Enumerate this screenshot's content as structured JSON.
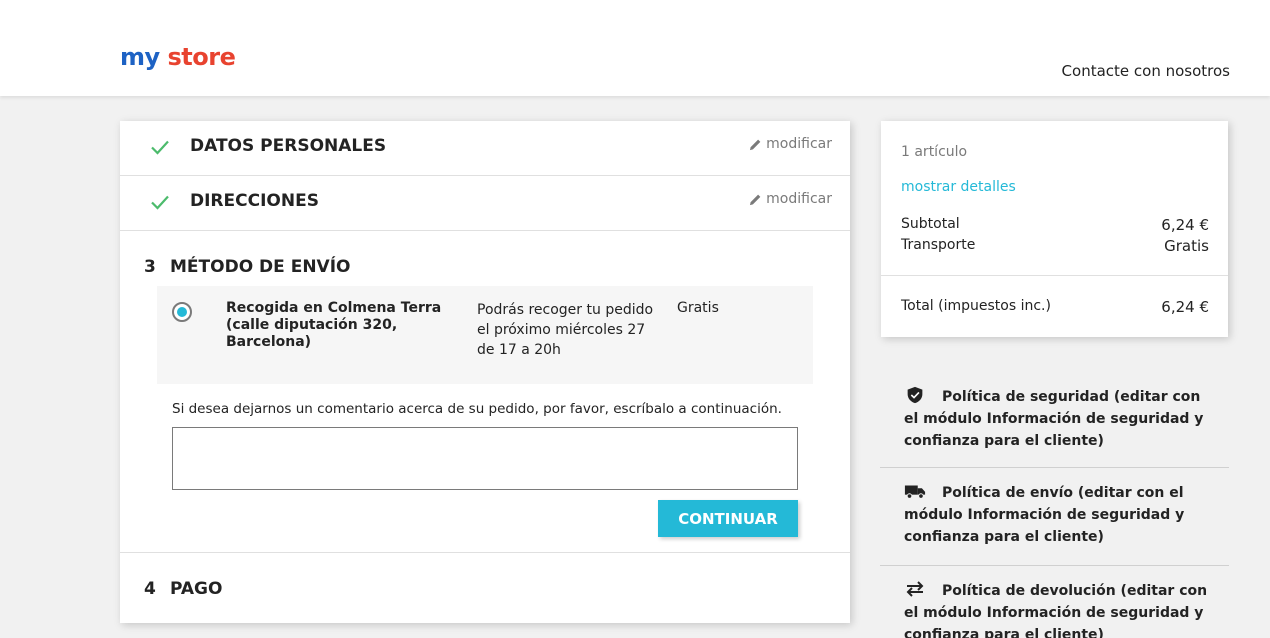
{
  "header": {
    "logo": {
      "part1": "my",
      "part2": "store"
    },
    "contact_link": "Contacte con nosotros"
  },
  "steps": [
    {
      "title": "Datos personales",
      "modify_label": "modificar",
      "status": "complete"
    },
    {
      "title": "Direcciones",
      "modify_label": "modificar",
      "status": "complete"
    },
    {
      "number": "3",
      "title": "Método de envío",
      "status": "current"
    },
    {
      "number": "4",
      "title": "Pago",
      "status": "pending"
    }
  ],
  "shipping": {
    "carrier_name": "Recogida en Colmena Terra (calle diputación 320, Barcelona)",
    "carrier_delay": "Podrás recoger tu pedido el próximo miércoles 27 de 17 a 20h",
    "carrier_price": "Gratis",
    "selected": true,
    "comment_label": "Si desea dejarnos un comentario acerca de su pedido, por favor, escríbalo a continuación.",
    "comment_value": "",
    "continue_label": "Continuar"
  },
  "summary": {
    "items_count": "1 artículo",
    "show_details": "mostrar detalles",
    "subtotal_label": "Subtotal",
    "subtotal_value": "6,24 €",
    "shipping_label": "Transporte",
    "shipping_value": "Gratis",
    "total_label": "Total (impuestos inc.)",
    "total_value": "6,24 €"
  },
  "reassurance": [
    {
      "icon": "shield-icon",
      "text": "Política de seguridad (editar con el módulo Información de seguridad y confianza para el cliente)"
    },
    {
      "icon": "truck-icon",
      "text": "Política de envío (editar con el módulo Información de seguridad y confianza para el cliente)"
    },
    {
      "icon": "swap-arrows-icon",
      "text": "Política de devolución (editar con el módulo Información de seguridad y confianza para el cliente)"
    }
  ],
  "colors": {
    "accent": "#24b9d7",
    "check": "#4cbb6c",
    "text": "#232323",
    "muted": "#7a7a7a"
  }
}
